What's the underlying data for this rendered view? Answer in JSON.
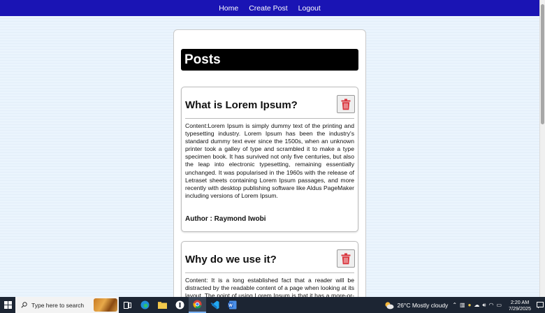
{
  "nav": {
    "items": [
      "Home",
      "Create Post",
      "Logout"
    ]
  },
  "posts_heading": "Posts",
  "posts": [
    {
      "title": "What is Lorem Ipsum?",
      "content": "Content:Lorem Ipsum is simply dummy text of the printing and typesetting industry. Lorem Ipsum has been the industry's standard dummy text ever since the 1500s, when an unknown printer took a galley of type and scrambled it to make a type specimen book. It has survived not only five centuries, but also the leap into electronic typesetting, remaining essentially unchanged. It was popularised in the 1960s with the release of Letraset sheets containing Lorem Ipsum passages, and more recently with desktop publishing software like Aldus PageMaker including versions of Lorem Ipsum.",
      "author": "Author : Raymond Iwobi"
    },
    {
      "title": "Why do we use it?",
      "content": "Content: It is a long established fact that a reader will be distracted by the readable content of a page when looking at its layout. The point of using Lorem Ipsum is that it has a more-or-less normal distribution of letters, as opposed to using 'Content here, content here', making it look like readable English.",
      "author": ""
    }
  ],
  "taskbar": {
    "search_placeholder": "Type here to search",
    "weather": "26°C  Mostly cloudy",
    "time": "2:20 AM",
    "date": "7/29/2025"
  },
  "colors": {
    "navbar": "#1a14b4",
    "delete_icon": "#d9363e",
    "posts_header_bg": "#000000"
  }
}
